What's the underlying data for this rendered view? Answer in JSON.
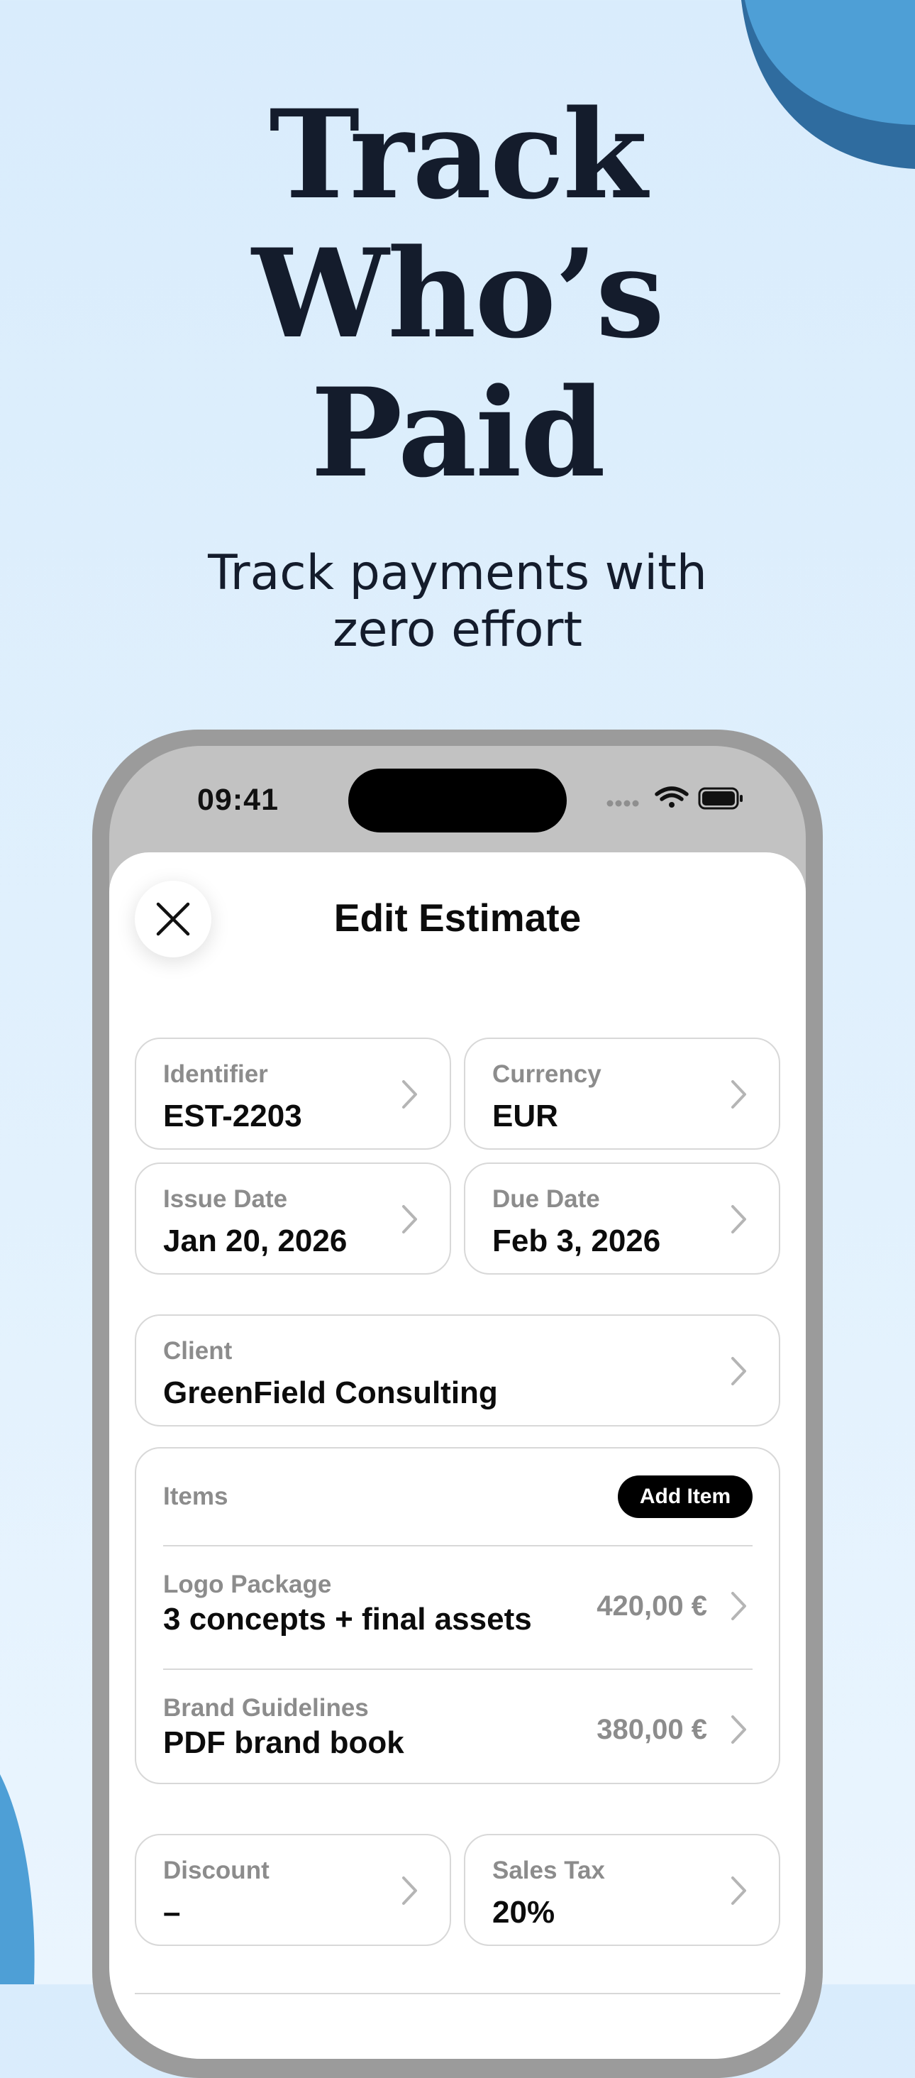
{
  "colors": {
    "background": "#dcedfc",
    "accent_blob": "#4e9fd6",
    "accent_blob_dark": "#2f6c9f",
    "headline": "#141c2c",
    "button_black": "#000000"
  },
  "hero": {
    "headline_lines": [
      "Track",
      "Who’s",
      "Paid"
    ],
    "subhead_lines": [
      "Track payments with",
      "zero effort"
    ]
  },
  "status_bar": {
    "time": "09:41",
    "icons": [
      "signal-dots-icon",
      "wifi-icon",
      "battery-icon"
    ]
  },
  "sheet": {
    "title": "Edit Estimate",
    "close_icon": "close-icon"
  },
  "fields": {
    "identifier": {
      "label": "Identifier",
      "value": "EST-2203"
    },
    "currency": {
      "label": "Currency",
      "value": "EUR"
    },
    "issue_date": {
      "label": "Issue Date",
      "value": "Jan 20, 2026"
    },
    "due_date": {
      "label": "Due Date",
      "value": "Feb 3, 2026"
    },
    "client": {
      "label": "Client",
      "value": "GreenField Consulting"
    },
    "discount": {
      "label": "Discount",
      "value": "–"
    },
    "sales_tax": {
      "label": "Sales Tax",
      "value": "20%"
    }
  },
  "items": {
    "label": "Items",
    "add_button": "Add Item",
    "rows": [
      {
        "name": "Logo Package",
        "description": "3 concepts + final assets",
        "price": "420,00 €"
      },
      {
        "name": "Brand Guidelines",
        "description": "PDF brand book",
        "price": "380,00 €"
      }
    ]
  }
}
